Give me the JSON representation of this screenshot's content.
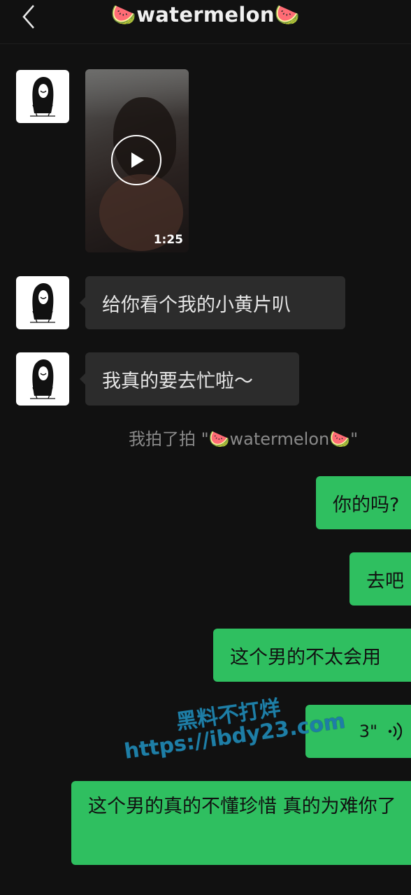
{
  "header": {
    "back_icon": "chevron-left-icon",
    "title": "🍉watermelon🍉"
  },
  "messages": {
    "video": {
      "duration": "1:25",
      "play_icon": "play-icon"
    },
    "text1": "给你看个我的小黄片叭",
    "text2": "我真的要去忙啦～",
    "system": "我拍了拍 \"🍉watermelon🍉\"",
    "out1": "你的吗?",
    "out2": "去吧",
    "out3": "这个男的不太会用",
    "voice": {
      "duration": "3\"",
      "icon": "voice-wave-icon"
    },
    "out4": "这个男的真的不懂珍惜 真的为难你了"
  },
  "watermark": {
    "line1": "黑料不打烊",
    "line2": "https://ibdy23.com"
  },
  "colors": {
    "background": "#111111",
    "incoming_bubble": "#2c2c2c",
    "outgoing_bubble": "#2fbf60",
    "watermark": "#1e7ea6"
  }
}
